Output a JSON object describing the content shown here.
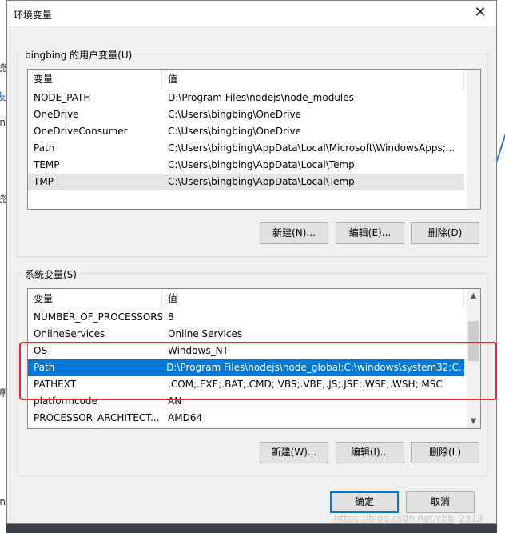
{
  "dialog": {
    "title": "环境变量",
    "close_glyph": "✕"
  },
  "user_vars": {
    "group_label": "bingbing 的用户变量(U)",
    "headers": [
      "变量",
      "值"
    ],
    "rows": [
      {
        "name": "NODE_PATH",
        "value": "D:\\Program Files\\nodejs\\node_modules"
      },
      {
        "name": "OneDrive",
        "value": "C:\\Users\\bingbing\\OneDrive"
      },
      {
        "name": "OneDriveConsumer",
        "value": "C:\\Users\\bingbing\\OneDrive"
      },
      {
        "name": "Path",
        "value": "C:\\Users\\bingbing\\AppData\\Local\\Microsoft\\WindowsApps;..."
      },
      {
        "name": "TEMP",
        "value": "C:\\Users\\bingbing\\AppData\\Local\\Temp"
      },
      {
        "name": "TMP",
        "value": "C:\\Users\\bingbing\\AppData\\Local\\Temp"
      }
    ],
    "buttons": {
      "new": "新建(N)...",
      "edit": "编辑(E)...",
      "delete": "删除(D)"
    }
  },
  "system_vars": {
    "group_label": "系统变量(S)",
    "headers": [
      "变量",
      "值"
    ],
    "rows": [
      {
        "name": "NUMBER_OF_PROCESSORS",
        "value": "8"
      },
      {
        "name": "OnlineServices",
        "value": "Online Services"
      },
      {
        "name": "OS",
        "value": "Windows_NT"
      },
      {
        "name": "Path",
        "value": "D:\\Program Files\\nodejs\\node_global;C:\\windows\\system32;C..."
      },
      {
        "name": "PATHEXT",
        "value": ".COM;.EXE;.BAT;.CMD;.VBS;.VBE;.JS;.JSE;.WSF;.WSH;.MSC"
      },
      {
        "name": "platformcode",
        "value": "AN"
      },
      {
        "name": "PROCESSOR_ARCHITECT...",
        "value": "AMD64"
      }
    ],
    "selected_row": "Path",
    "buttons": {
      "new": "新建(W)...",
      "edit": "编辑(I)...",
      "delete": "删除(L)"
    }
  },
  "footer": {
    "ok": "确定",
    "cancel": "取消"
  },
  "watermark": "https://blog.csdn.net/cbb_2313",
  "background_fragments": [
    "统",
    "友",
    "in",
    "统",
    "算",
    "in"
  ],
  "colors": {
    "selection": "#0078d7",
    "highlight_box": "#e8222a"
  }
}
